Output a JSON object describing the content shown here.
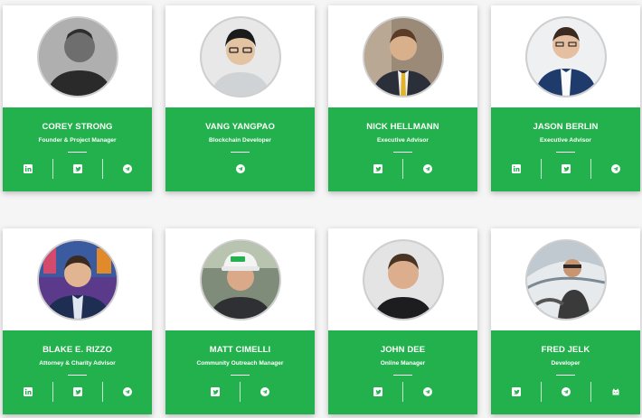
{
  "team": [
    {
      "name": "COREY STRONG",
      "role": "Founder & Project Manager",
      "photo": "bw",
      "icons": [
        "linkedin-icon",
        "twitter-icon",
        "telegram-icon"
      ]
    },
    {
      "name": "VANG YANGPAO",
      "role": "Blockchain Developer",
      "photo": "light",
      "icons": [
        "telegram-icon"
      ]
    },
    {
      "name": "NICK HELLMANN",
      "role": "Executive Advisor",
      "photo": "suit",
      "icons": [
        "twitter-icon",
        "telegram-icon"
      ]
    },
    {
      "name": "JASON BERLIN",
      "role": "Executive Advisor",
      "photo": "navy",
      "icons": [
        "linkedin-icon",
        "twitter-icon",
        "telegram-icon"
      ]
    },
    {
      "name": "BLAKE E. RIZZO",
      "role": "Attorney & Charity Advisor",
      "photo": "studio",
      "icons": [
        "linkedin-icon",
        "twitter-icon",
        "telegram-icon"
      ]
    },
    {
      "name": "MATT CIMELLI",
      "role": "Community Outreach Manager",
      "photo": "cap",
      "icons": [
        "twitter-icon",
        "telegram-icon"
      ]
    },
    {
      "name": "JOHN DEE",
      "role": "Online Manager",
      "photo": "plain",
      "icons": [
        "twitter-icon",
        "telegram-icon"
      ]
    },
    {
      "name": "FRED JELK",
      "role": "Developer",
      "photo": "boat",
      "icons": [
        "twitter-icon",
        "telegram-icon",
        "github-icon"
      ]
    }
  ],
  "colors": {
    "accent": "#22b14c",
    "card": "#ffffff",
    "page": "#f5f5f5"
  }
}
